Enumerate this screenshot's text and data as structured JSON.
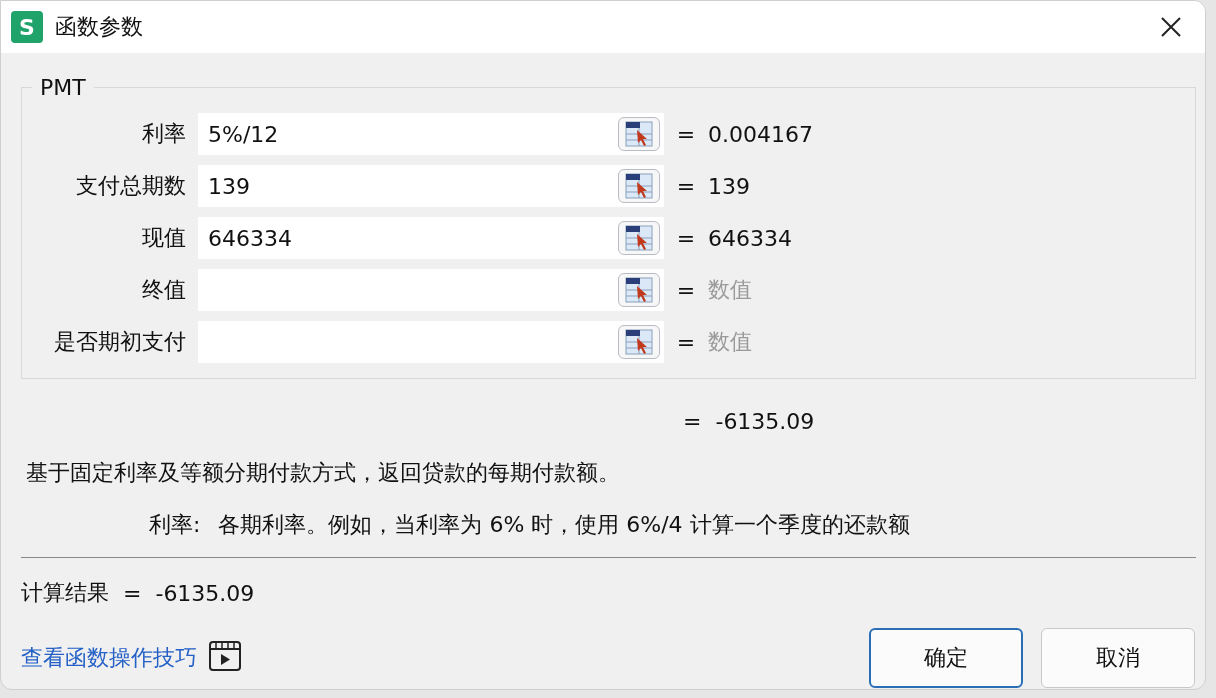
{
  "window": {
    "title": "函数参数",
    "app_icon_letter": "S"
  },
  "function_name": "PMT",
  "arguments": [
    {
      "label": "利率",
      "value": "5%/12",
      "equals": "=",
      "result": "0.004167",
      "result_is_hint": false
    },
    {
      "label": "支付总期数",
      "value": "139",
      "equals": "=",
      "result": "139",
      "result_is_hint": false
    },
    {
      "label": "现值",
      "value": "646334",
      "equals": "=",
      "result": "646334",
      "result_is_hint": false
    },
    {
      "label": "终值",
      "equals": "=",
      "result": "数值",
      "result_is_hint": true
    },
    {
      "label": "是否期初支付",
      "equals": "=",
      "result": "数值",
      "result_is_hint": true
    }
  ],
  "formula_result": {
    "equals": "=",
    "value": "-6135.09"
  },
  "description": "基于固定利率及等额分期付款方式，返回贷款的每期付款额。",
  "argument_help": {
    "name": "利率:",
    "text": "各期利率。例如，当利率为 6% 时，使用 6%/4 计算一个季度的还款额"
  },
  "calculation": {
    "label": "计算结果",
    "equals": "=",
    "value": "-6135.09"
  },
  "tips_link": "查看函数操作技巧",
  "buttons": [
    {
      "label": "确定",
      "default": true
    },
    {
      "label": "取消",
      "default": false
    }
  ]
}
